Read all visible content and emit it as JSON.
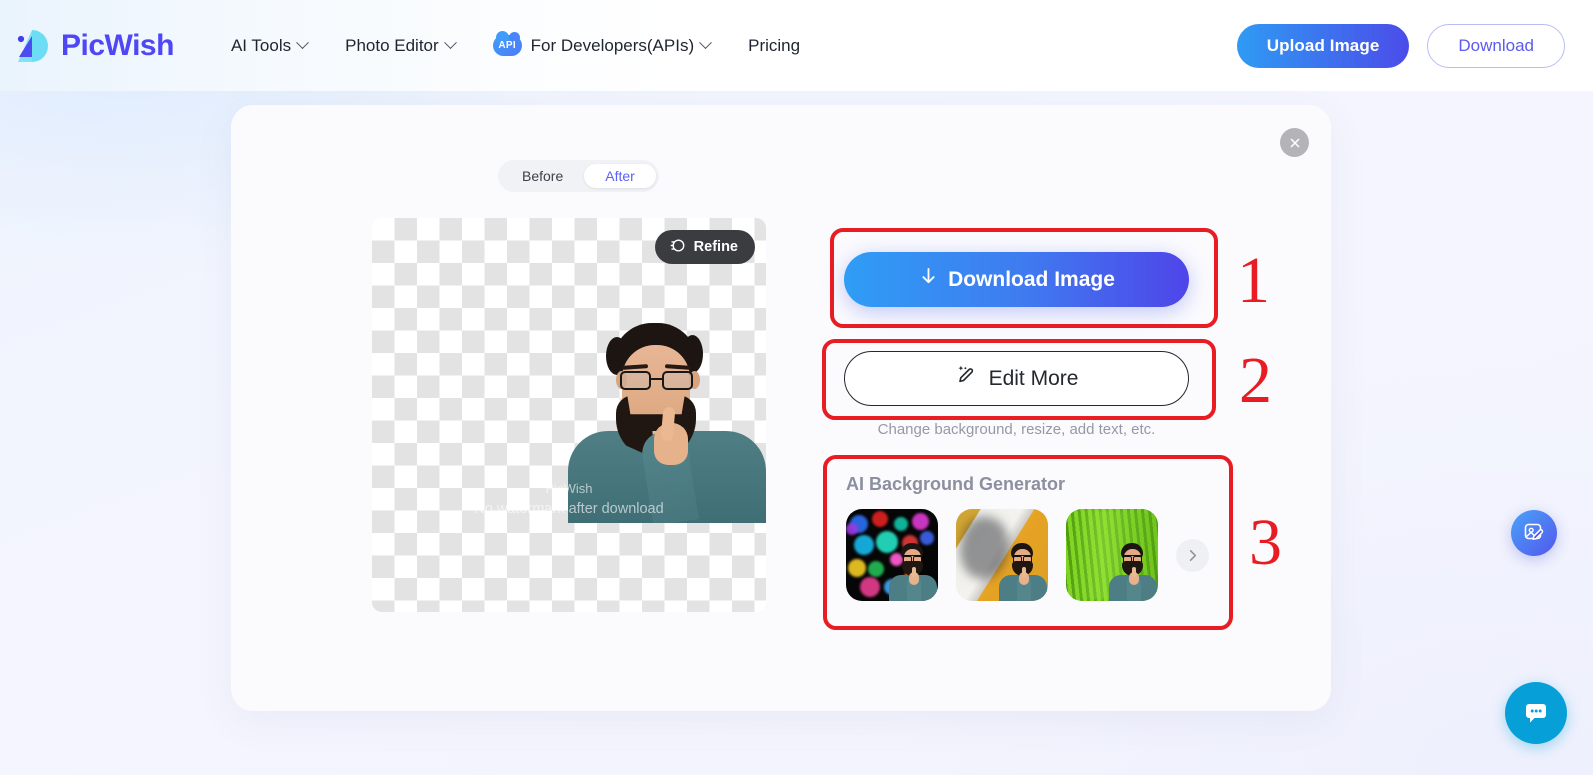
{
  "header": {
    "logo_text": "PicWish",
    "logo_icon": "picwish-logo-icon",
    "nav": [
      {
        "label": "AI Tools",
        "has_dropdown": true,
        "icon": null
      },
      {
        "label": "Photo Editor",
        "has_dropdown": true,
        "icon": null
      },
      {
        "label": "For Developers(APIs)",
        "has_dropdown": true,
        "icon": "api-cloud-badge",
        "badge_text": "API"
      },
      {
        "label": "Pricing",
        "has_dropdown": false,
        "icon": null
      }
    ],
    "upload_label": "Upload Image",
    "download_label": "Download"
  },
  "card": {
    "close_icon": "close-icon",
    "toggle": {
      "options": [
        "Before",
        "After"
      ],
      "active": "After"
    },
    "preview": {
      "refine_label": "Refine",
      "refine_icon": "refine-icon",
      "watermark_line1": "PicWish",
      "watermark_line2": "No watermark after download"
    },
    "actions": {
      "download_image_label": "Download Image",
      "download_icon": "download-arrow-icon",
      "edit_more_label": "Edit More",
      "edit_more_icon": "magic-pencil-icon",
      "edit_more_hint": "Change background, resize, add text, etc."
    },
    "bg_generator": {
      "title": "AI Background Generator",
      "next_icon": "chevron-right-icon",
      "thumbnails": [
        {
          "name": "colorful-bokeh-background"
        },
        {
          "name": "yellow-white-shadow-background"
        },
        {
          "name": "green-leaf-background"
        }
      ]
    }
  },
  "annotations": [
    {
      "number": "1",
      "target": "download-image-button"
    },
    {
      "number": "2",
      "target": "edit-more-button"
    },
    {
      "number": "3",
      "target": "ai-background-generator"
    }
  ],
  "floating": {
    "edit_icon": "photo-edit-floating-icon",
    "chat_icon": "chat-bubble-icon"
  },
  "colors": {
    "accent_blue": "#2f9df5",
    "accent_purple": "#4f45e9",
    "annotation_red": "#e81c23",
    "brand_indigo": "#4f46f5",
    "chat_blue": "#069fd8"
  }
}
